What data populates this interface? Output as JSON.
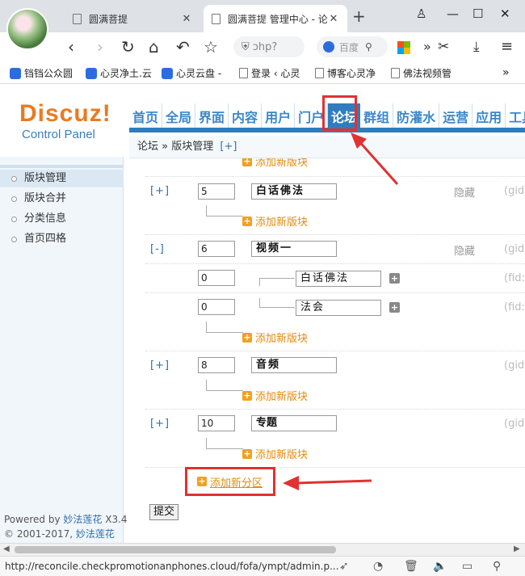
{
  "browser": {
    "tabs": [
      {
        "title": "圆满菩提",
        "active": false
      },
      {
        "title": "圆满菩提 管理中心 - 论",
        "active": true
      }
    ],
    "new_tab": "+",
    "address_text": "ɔhp?",
    "search_text": "百度",
    "bookmarks": [
      "铛铛公众圆",
      "心灵净土.云",
      "心灵云盘 -",
      "登录 ‹ 心灵",
      "博客心灵净",
      "佛法视频管"
    ],
    "bookmarks_more": "»",
    "status_url": "http://reconcile.checkpromotionanphones.cloud/fofa/ympt/admin.p..."
  },
  "header": {
    "logo": "Discuz!",
    "subtitle": "Control Panel",
    "nav": [
      "首页",
      "全局",
      "界面",
      "内容",
      "用户",
      "门户",
      "论坛",
      "群组",
      "防灌水",
      "运营",
      "应用",
      "工具"
    ],
    "active_nav": "论坛"
  },
  "sidebar": {
    "items": [
      {
        "label": "版块管理",
        "active": true
      },
      {
        "label": "版块合并",
        "active": false
      },
      {
        "label": "分类信息",
        "active": false
      },
      {
        "label": "首页四格",
        "active": false
      }
    ],
    "powered_prefix": "Powered by",
    "powered_link": "妙法莲花",
    "version": "X3.4",
    "copyright_prefix": "© 2001-2017,",
    "copyright_link": "妙法莲花"
  },
  "breadcrumb": {
    "root": "论坛",
    "sep": "»",
    "page": "版块管理",
    "add": "[+]"
  },
  "forum": {
    "add_forum": "添加新版块",
    "hidden": "隐藏",
    "gid_label": "(gid:",
    "fid_label": "(fid:",
    "group_1": {
      "toggle": "[+]",
      "order": "5",
      "name": "白话佛法"
    },
    "group_2": {
      "toggle": "[-]",
      "order": "6",
      "name": "视频一"
    },
    "sub_1": {
      "order": "0",
      "name": "白话佛法"
    },
    "sub_2": {
      "order": "0",
      "name": "法会"
    },
    "group_3": {
      "toggle": "[+]",
      "order": "8",
      "name": "音频"
    },
    "group_4": {
      "toggle": "[+]",
      "order": "10",
      "name": "专题"
    },
    "add_category": "添加新分区",
    "submit": "提交"
  }
}
